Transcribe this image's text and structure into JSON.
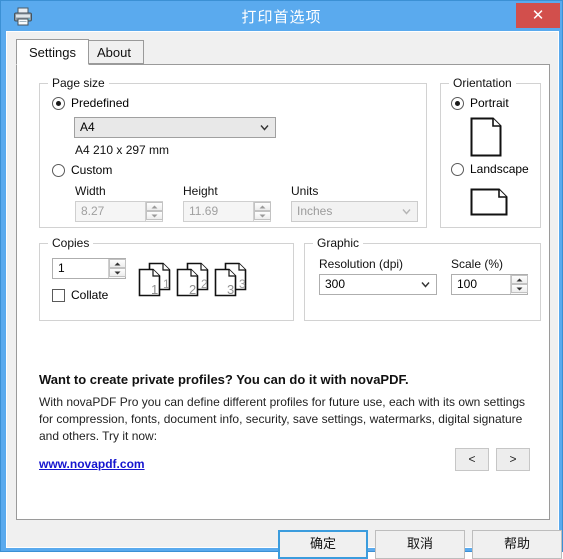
{
  "window": {
    "title": "打印首选项",
    "app_icon": "printer-icon",
    "close_label": "✕",
    "titlebar_color": "#5aaaee",
    "close_color": "#d24f4c"
  },
  "tabs": [
    {
      "id": "settings",
      "label": "Settings",
      "active": true
    },
    {
      "id": "about",
      "label": "About",
      "active": false
    }
  ],
  "page_size": {
    "group_label": "Page size",
    "predefined": {
      "label": "Predefined",
      "checked": true
    },
    "preset_combo": {
      "value": "A4",
      "enabled": true
    },
    "dimension_text": "A4 210 x 297 mm",
    "custom": {
      "label": "Custom",
      "checked": false
    },
    "width": {
      "label": "Width",
      "value": "8.27",
      "enabled": false
    },
    "height": {
      "label": "Height",
      "value": "11.69",
      "enabled": false
    },
    "units": {
      "label": "Units",
      "value": "Inches",
      "enabled": false
    }
  },
  "orientation": {
    "group_label": "Orientation",
    "portrait": {
      "label": "Portrait",
      "checked": true
    },
    "landscape": {
      "label": "Landscape",
      "checked": false
    }
  },
  "copies": {
    "group_label": "Copies",
    "count": "1",
    "collate": {
      "label": "Collate",
      "checked": false
    },
    "preview_numbers": [
      "1",
      "2",
      "3"
    ]
  },
  "graphic": {
    "group_label": "Graphic",
    "resolution": {
      "label": "Resolution (dpi)",
      "value": "300"
    },
    "scale": {
      "label": "Scale (%)",
      "value": "100"
    }
  },
  "promo": {
    "headline": "Want to create private profiles? You can do it with novaPDF.",
    "body": "With novaPDF Pro you can define different profiles for future use, each with its own settings for compression, fonts, document info, security, save settings, watermarks, digital signature and others. Try it now:",
    "link": "www.novapdf.com",
    "link_color": "#1515cf",
    "prev_label": "<",
    "next_label": ">"
  },
  "footer": {
    "ok": "确定",
    "cancel": "取消",
    "help": "帮助",
    "focus_color": "#3b9cdd"
  }
}
